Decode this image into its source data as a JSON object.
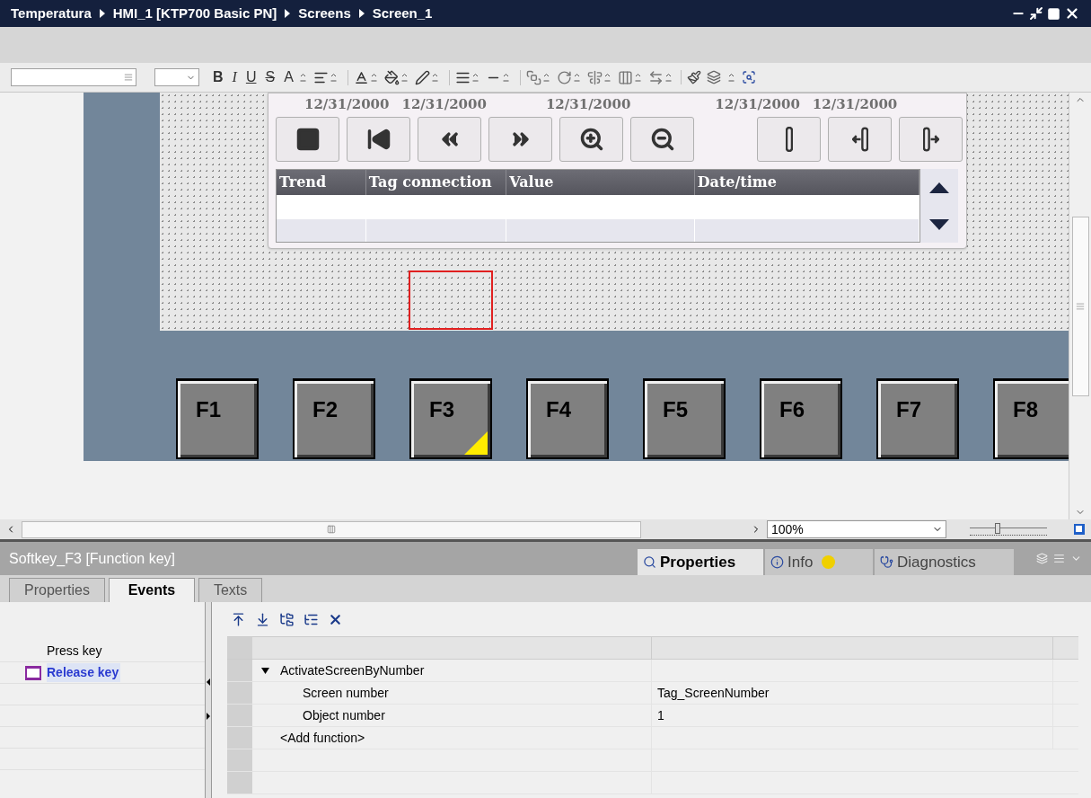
{
  "window": {
    "breadcrumbs": [
      "Temperatura",
      "HMI_1 [KTP700 Basic PN]",
      "Screens",
      "Screen_1"
    ]
  },
  "toolbar": {
    "text_buttons": [
      {
        "label": "B",
        "kind": "bold"
      },
      {
        "label": "I",
        "kind": "italic"
      },
      {
        "label": "U",
        "kind": "underline"
      },
      {
        "label": "S",
        "kind": "strike"
      },
      {
        "label": "A",
        "kind": "grow"
      }
    ]
  },
  "trend_view": {
    "dates": [
      "12/31/2000",
      "12/31/2000",
      "12/31/2000",
      "12/31/2000",
      "12/31/2000"
    ],
    "columns": [
      "Trend",
      "Tag connection",
      "Value",
      "Date/time"
    ]
  },
  "function_keys": [
    {
      "label": "F1",
      "has_event": false
    },
    {
      "label": "F2",
      "has_event": false
    },
    {
      "label": "F3",
      "has_event": true
    },
    {
      "label": "F4",
      "has_event": false
    },
    {
      "label": "F5",
      "has_event": false
    },
    {
      "label": "F6",
      "has_event": false
    },
    {
      "label": "F7",
      "has_event": false
    },
    {
      "label": "F8",
      "has_event": false
    }
  ],
  "zoom": {
    "value": "100%",
    "level": 0.35
  },
  "inspector": {
    "title": "Softkey_F3 [Function key]",
    "tabs": [
      {
        "label": "Properties",
        "selected": true,
        "kind": "properties"
      },
      {
        "label": "Info",
        "selected": false,
        "kind": "info"
      },
      {
        "label": "Diagnostics",
        "selected": false,
        "kind": "diagnostics"
      }
    ],
    "subtabs": [
      {
        "label": "Properties",
        "selected": false
      },
      {
        "label": "Events",
        "selected": true
      },
      {
        "label": "Texts",
        "selected": false
      }
    ],
    "events": [
      {
        "label": "Press key",
        "selected": false
      },
      {
        "label": "Release key",
        "selected": true
      }
    ],
    "functions": [
      {
        "kind": "function",
        "name": "ActivateScreenByNumber",
        "expanded": true
      },
      {
        "kind": "param",
        "name": "Screen number",
        "value": "Tag_ScreenNumber"
      },
      {
        "kind": "param",
        "name": "Object number",
        "value": "1"
      },
      {
        "kind": "add",
        "name": "<Add function>"
      }
    ]
  }
}
